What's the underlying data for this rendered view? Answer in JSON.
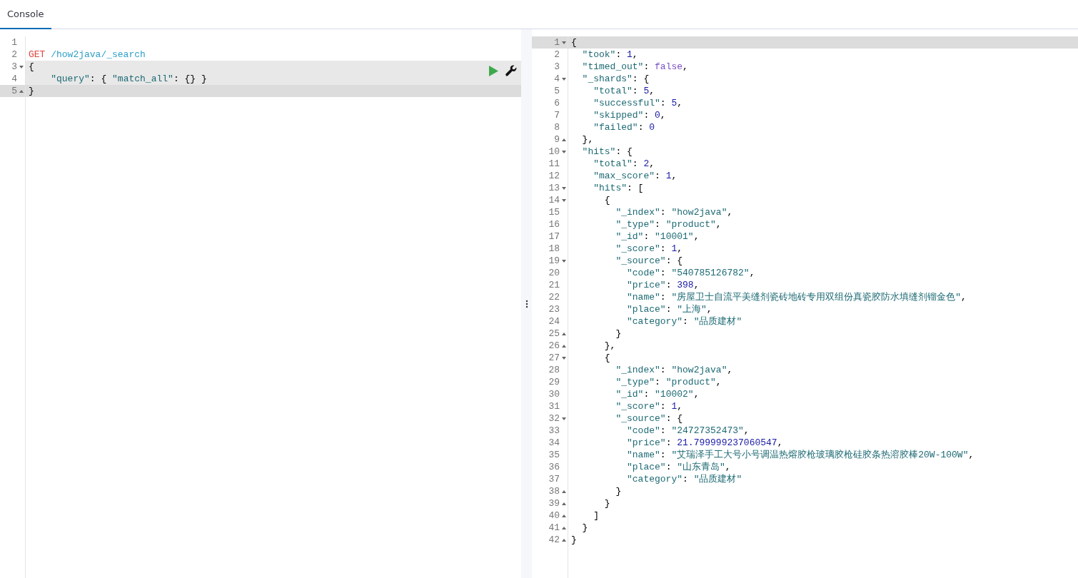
{
  "tabs": [
    {
      "label": "Console",
      "selected": true
    }
  ],
  "request": {
    "lines": [
      {
        "number": "1",
        "fold_start": false,
        "fold_end": false,
        "in_block": false,
        "active": false
      },
      {
        "number": "2",
        "fold_start": false,
        "fold_end": false,
        "in_block": false,
        "active": false,
        "tokens": [
          {
            "kind": "method",
            "text": "GET"
          },
          {
            "kind": "url",
            "text": " /how2java/_search"
          }
        ]
      },
      {
        "number": "3",
        "fold_start": true,
        "fold_end": false,
        "in_block": true,
        "active": false,
        "tokens": [
          {
            "kind": "punct",
            "text": "{"
          }
        ]
      },
      {
        "number": "4",
        "fold_start": false,
        "fold_end": false,
        "in_block": true,
        "active": false,
        "tokens": [
          {
            "kind": "str",
            "text": "    \"query\""
          },
          {
            "kind": "punct",
            "text": ": { "
          },
          {
            "kind": "str",
            "text": "\"match_all\""
          },
          {
            "kind": "punct",
            "text": ": {} }"
          }
        ]
      },
      {
        "number": "5",
        "fold_start": false,
        "fold_end": true,
        "in_block": false,
        "active": true,
        "tokens": [
          {
            "kind": "punct",
            "text": "}"
          }
        ]
      }
    ]
  },
  "response": {
    "lines": [
      {
        "number": "1",
        "fold_start": true,
        "fold_end": false,
        "active": true,
        "tokens": [
          {
            "kind": "punct",
            "text": "{"
          }
        ]
      },
      {
        "number": "2",
        "fold_start": false,
        "fold_end": false,
        "active": false,
        "tokens": [
          {
            "kind": "str",
            "text": "  \"took\""
          },
          {
            "kind": "punct",
            "text": ": "
          },
          {
            "kind": "num",
            "text": "1"
          },
          {
            "kind": "punct",
            "text": ","
          }
        ]
      },
      {
        "number": "3",
        "fold_start": false,
        "fold_end": false,
        "active": false,
        "tokens": [
          {
            "kind": "str",
            "text": "  \"timed_out\""
          },
          {
            "kind": "punct",
            "text": ": "
          },
          {
            "kind": "bool",
            "text": "false"
          },
          {
            "kind": "punct",
            "text": ","
          }
        ]
      },
      {
        "number": "4",
        "fold_start": true,
        "fold_end": false,
        "active": false,
        "tokens": [
          {
            "kind": "str",
            "text": "  \"_shards\""
          },
          {
            "kind": "punct",
            "text": ": {"
          }
        ]
      },
      {
        "number": "5",
        "fold_start": false,
        "fold_end": false,
        "active": false,
        "tokens": [
          {
            "kind": "str",
            "text": "    \"total\""
          },
          {
            "kind": "punct",
            "text": ": "
          },
          {
            "kind": "num",
            "text": "5"
          },
          {
            "kind": "punct",
            "text": ","
          }
        ]
      },
      {
        "number": "6",
        "fold_start": false,
        "fold_end": false,
        "active": false,
        "tokens": [
          {
            "kind": "str",
            "text": "    \"successful\""
          },
          {
            "kind": "punct",
            "text": ": "
          },
          {
            "kind": "num",
            "text": "5"
          },
          {
            "kind": "punct",
            "text": ","
          }
        ]
      },
      {
        "number": "7",
        "fold_start": false,
        "fold_end": false,
        "active": false,
        "tokens": [
          {
            "kind": "str",
            "text": "    \"skipped\""
          },
          {
            "kind": "punct",
            "text": ": "
          },
          {
            "kind": "num",
            "text": "0"
          },
          {
            "kind": "punct",
            "text": ","
          }
        ]
      },
      {
        "number": "8",
        "fold_start": false,
        "fold_end": false,
        "active": false,
        "tokens": [
          {
            "kind": "str",
            "text": "    \"failed\""
          },
          {
            "kind": "punct",
            "text": ": "
          },
          {
            "kind": "num",
            "text": "0"
          }
        ]
      },
      {
        "number": "9",
        "fold_start": false,
        "fold_end": true,
        "active": false,
        "tokens": [
          {
            "kind": "punct",
            "text": "  },"
          }
        ]
      },
      {
        "number": "10",
        "fold_start": true,
        "fold_end": false,
        "active": false,
        "tokens": [
          {
            "kind": "str",
            "text": "  \"hits\""
          },
          {
            "kind": "punct",
            "text": ": {"
          }
        ]
      },
      {
        "number": "11",
        "fold_start": false,
        "fold_end": false,
        "active": false,
        "tokens": [
          {
            "kind": "str",
            "text": "    \"total\""
          },
          {
            "kind": "punct",
            "text": ": "
          },
          {
            "kind": "num",
            "text": "2"
          },
          {
            "kind": "punct",
            "text": ","
          }
        ]
      },
      {
        "number": "12",
        "fold_start": false,
        "fold_end": false,
        "active": false,
        "tokens": [
          {
            "kind": "str",
            "text": "    \"max_score\""
          },
          {
            "kind": "punct",
            "text": ": "
          },
          {
            "kind": "num",
            "text": "1"
          },
          {
            "kind": "punct",
            "text": ","
          }
        ]
      },
      {
        "number": "13",
        "fold_start": true,
        "fold_end": false,
        "active": false,
        "tokens": [
          {
            "kind": "str",
            "text": "    \"hits\""
          },
          {
            "kind": "punct",
            "text": ": ["
          }
        ]
      },
      {
        "number": "14",
        "fold_start": true,
        "fold_end": false,
        "active": false,
        "tokens": [
          {
            "kind": "punct",
            "text": "      {"
          }
        ]
      },
      {
        "number": "15",
        "fold_start": false,
        "fold_end": false,
        "active": false,
        "tokens": [
          {
            "kind": "str",
            "text": "        \"_index\""
          },
          {
            "kind": "punct",
            "text": ": "
          },
          {
            "kind": "str",
            "text": "\"how2java\""
          },
          {
            "kind": "punct",
            "text": ","
          }
        ]
      },
      {
        "number": "16",
        "fold_start": false,
        "fold_end": false,
        "active": false,
        "tokens": [
          {
            "kind": "str",
            "text": "        \"_type\""
          },
          {
            "kind": "punct",
            "text": ": "
          },
          {
            "kind": "str",
            "text": "\"product\""
          },
          {
            "kind": "punct",
            "text": ","
          }
        ]
      },
      {
        "number": "17",
        "fold_start": false,
        "fold_end": false,
        "active": false,
        "tokens": [
          {
            "kind": "str",
            "text": "        \"_id\""
          },
          {
            "kind": "punct",
            "text": ": "
          },
          {
            "kind": "str",
            "text": "\"10001\""
          },
          {
            "kind": "punct",
            "text": ","
          }
        ]
      },
      {
        "number": "18",
        "fold_start": false,
        "fold_end": false,
        "active": false,
        "tokens": [
          {
            "kind": "str",
            "text": "        \"_score\""
          },
          {
            "kind": "punct",
            "text": ": "
          },
          {
            "kind": "num",
            "text": "1"
          },
          {
            "kind": "punct",
            "text": ","
          }
        ]
      },
      {
        "number": "19",
        "fold_start": true,
        "fold_end": false,
        "active": false,
        "tokens": [
          {
            "kind": "str",
            "text": "        \"_source\""
          },
          {
            "kind": "punct",
            "text": ": {"
          }
        ]
      },
      {
        "number": "20",
        "fold_start": false,
        "fold_end": false,
        "active": false,
        "tokens": [
          {
            "kind": "str",
            "text": "          \"code\""
          },
          {
            "kind": "punct",
            "text": ": "
          },
          {
            "kind": "str",
            "text": "\"540785126782\""
          },
          {
            "kind": "punct",
            "text": ","
          }
        ]
      },
      {
        "number": "21",
        "fold_start": false,
        "fold_end": false,
        "active": false,
        "tokens": [
          {
            "kind": "str",
            "text": "          \"price\""
          },
          {
            "kind": "punct",
            "text": ": "
          },
          {
            "kind": "num",
            "text": "398"
          },
          {
            "kind": "punct",
            "text": ","
          }
        ]
      },
      {
        "number": "22",
        "fold_start": false,
        "fold_end": false,
        "active": false,
        "tokens": [
          {
            "kind": "str",
            "text": "          \"name\""
          },
          {
            "kind": "punct",
            "text": ": "
          },
          {
            "kind": "str",
            "text": "\"房屋卫士自流平美缝剂瓷砖地砖专用双组份真瓷胶防水填缝剂镏金色\""
          },
          {
            "kind": "punct",
            "text": ","
          }
        ]
      },
      {
        "number": "23",
        "fold_start": false,
        "fold_end": false,
        "active": false,
        "tokens": [
          {
            "kind": "str",
            "text": "          \"place\""
          },
          {
            "kind": "punct",
            "text": ": "
          },
          {
            "kind": "str",
            "text": "\"上海\""
          },
          {
            "kind": "punct",
            "text": ","
          }
        ]
      },
      {
        "number": "24",
        "fold_start": false,
        "fold_end": false,
        "active": false,
        "tokens": [
          {
            "kind": "str",
            "text": "          \"category\""
          },
          {
            "kind": "punct",
            "text": ": "
          },
          {
            "kind": "str",
            "text": "\"品质建材\""
          }
        ]
      },
      {
        "number": "25",
        "fold_start": false,
        "fold_end": true,
        "active": false,
        "tokens": [
          {
            "kind": "punct",
            "text": "        }"
          }
        ]
      },
      {
        "number": "26",
        "fold_start": false,
        "fold_end": true,
        "active": false,
        "tokens": [
          {
            "kind": "punct",
            "text": "      },"
          }
        ]
      },
      {
        "number": "27",
        "fold_start": true,
        "fold_end": false,
        "active": false,
        "tokens": [
          {
            "kind": "punct",
            "text": "      {"
          }
        ]
      },
      {
        "number": "28",
        "fold_start": false,
        "fold_end": false,
        "active": false,
        "tokens": [
          {
            "kind": "str",
            "text": "        \"_index\""
          },
          {
            "kind": "punct",
            "text": ": "
          },
          {
            "kind": "str",
            "text": "\"how2java\""
          },
          {
            "kind": "punct",
            "text": ","
          }
        ]
      },
      {
        "number": "29",
        "fold_start": false,
        "fold_end": false,
        "active": false,
        "tokens": [
          {
            "kind": "str",
            "text": "        \"_type\""
          },
          {
            "kind": "punct",
            "text": ": "
          },
          {
            "kind": "str",
            "text": "\"product\""
          },
          {
            "kind": "punct",
            "text": ","
          }
        ]
      },
      {
        "number": "30",
        "fold_start": false,
        "fold_end": false,
        "active": false,
        "tokens": [
          {
            "kind": "str",
            "text": "        \"_id\""
          },
          {
            "kind": "punct",
            "text": ": "
          },
          {
            "kind": "str",
            "text": "\"10002\""
          },
          {
            "kind": "punct",
            "text": ","
          }
        ]
      },
      {
        "number": "31",
        "fold_start": false,
        "fold_end": false,
        "active": false,
        "tokens": [
          {
            "kind": "str",
            "text": "        \"_score\""
          },
          {
            "kind": "punct",
            "text": ": "
          },
          {
            "kind": "num",
            "text": "1"
          },
          {
            "kind": "punct",
            "text": ","
          }
        ]
      },
      {
        "number": "32",
        "fold_start": true,
        "fold_end": false,
        "active": false,
        "tokens": [
          {
            "kind": "str",
            "text": "        \"_source\""
          },
          {
            "kind": "punct",
            "text": ": {"
          }
        ]
      },
      {
        "number": "33",
        "fold_start": false,
        "fold_end": false,
        "active": false,
        "tokens": [
          {
            "kind": "str",
            "text": "          \"code\""
          },
          {
            "kind": "punct",
            "text": ": "
          },
          {
            "kind": "str",
            "text": "\"24727352473\""
          },
          {
            "kind": "punct",
            "text": ","
          }
        ]
      },
      {
        "number": "34",
        "fold_start": false,
        "fold_end": false,
        "active": false,
        "tokens": [
          {
            "kind": "str",
            "text": "          \"price\""
          },
          {
            "kind": "punct",
            "text": ": "
          },
          {
            "kind": "num",
            "text": "21.799999237060547"
          },
          {
            "kind": "punct",
            "text": ","
          }
        ]
      },
      {
        "number": "35",
        "fold_start": false,
        "fold_end": false,
        "active": false,
        "tokens": [
          {
            "kind": "str",
            "text": "          \"name\""
          },
          {
            "kind": "punct",
            "text": ": "
          },
          {
            "kind": "str",
            "text": "\"艾瑞泽手工大号小号调温热熔胶枪玻璃胶枪硅胶条热溶胶棒20W-100W\""
          },
          {
            "kind": "punct",
            "text": ","
          }
        ]
      },
      {
        "number": "36",
        "fold_start": false,
        "fold_end": false,
        "active": false,
        "tokens": [
          {
            "kind": "str",
            "text": "          \"place\""
          },
          {
            "kind": "punct",
            "text": ": "
          },
          {
            "kind": "str",
            "text": "\"山东青岛\""
          },
          {
            "kind": "punct",
            "text": ","
          }
        ]
      },
      {
        "number": "37",
        "fold_start": false,
        "fold_end": false,
        "active": false,
        "tokens": [
          {
            "kind": "str",
            "text": "          \"category\""
          },
          {
            "kind": "punct",
            "text": ": "
          },
          {
            "kind": "str",
            "text": "\"品质建材\""
          }
        ]
      },
      {
        "number": "38",
        "fold_start": false,
        "fold_end": true,
        "active": false,
        "tokens": [
          {
            "kind": "punct",
            "text": "        }"
          }
        ]
      },
      {
        "number": "39",
        "fold_start": false,
        "fold_end": true,
        "active": false,
        "tokens": [
          {
            "kind": "punct",
            "text": "      }"
          }
        ]
      },
      {
        "number": "40",
        "fold_start": false,
        "fold_end": true,
        "active": false,
        "tokens": [
          {
            "kind": "punct",
            "text": "    ]"
          }
        ]
      },
      {
        "number": "41",
        "fold_start": false,
        "fold_end": true,
        "active": false,
        "tokens": [
          {
            "kind": "punct",
            "text": "  }"
          }
        ]
      },
      {
        "number": "42",
        "fold_start": false,
        "fold_end": true,
        "active": false,
        "tokens": [
          {
            "kind": "punct",
            "text": "}"
          }
        ]
      }
    ]
  }
}
